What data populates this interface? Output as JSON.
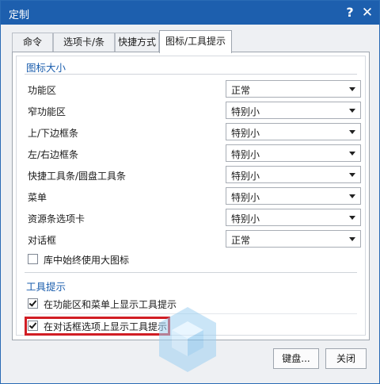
{
  "window": {
    "title": "定制",
    "help_label": "?",
    "close_label": "✕"
  },
  "tabs": [
    {
      "label": "命令"
    },
    {
      "label": "选项卡/条"
    },
    {
      "label": "快捷方式"
    },
    {
      "label": "图标/工具提示"
    }
  ],
  "icon_size": {
    "title": "图标大小",
    "rows": [
      {
        "label": "功能区",
        "value": "正常"
      },
      {
        "label": "窄功能区",
        "value": "特别小"
      },
      {
        "label": "上/下边框条",
        "value": "特别小"
      },
      {
        "label": "左/右边框条",
        "value": "特别小"
      },
      {
        "label": "快捷工具条/圆盘工具条",
        "value": "特别小"
      },
      {
        "label": "菜单",
        "value": "特别小"
      },
      {
        "label": "资源条选项卡",
        "value": "特别小"
      },
      {
        "label": "对话框",
        "value": "正常"
      }
    ],
    "always_large_label": "库中始终使用大图标",
    "always_large_checked": false
  },
  "tooltips": {
    "title": "工具提示",
    "ribbon_menu_label": "在功能区和菜单上显示工具提示",
    "ribbon_menu_checked": true,
    "dialog_label": "在对话框选项上显示工具提示",
    "dialog_checked": true
  },
  "buttons": {
    "keyboard": "键盘...",
    "close": "关闭"
  },
  "colors": {
    "titlebar": "#1d5fae",
    "section_title": "#1d5fae",
    "highlight": "#d11d24"
  }
}
